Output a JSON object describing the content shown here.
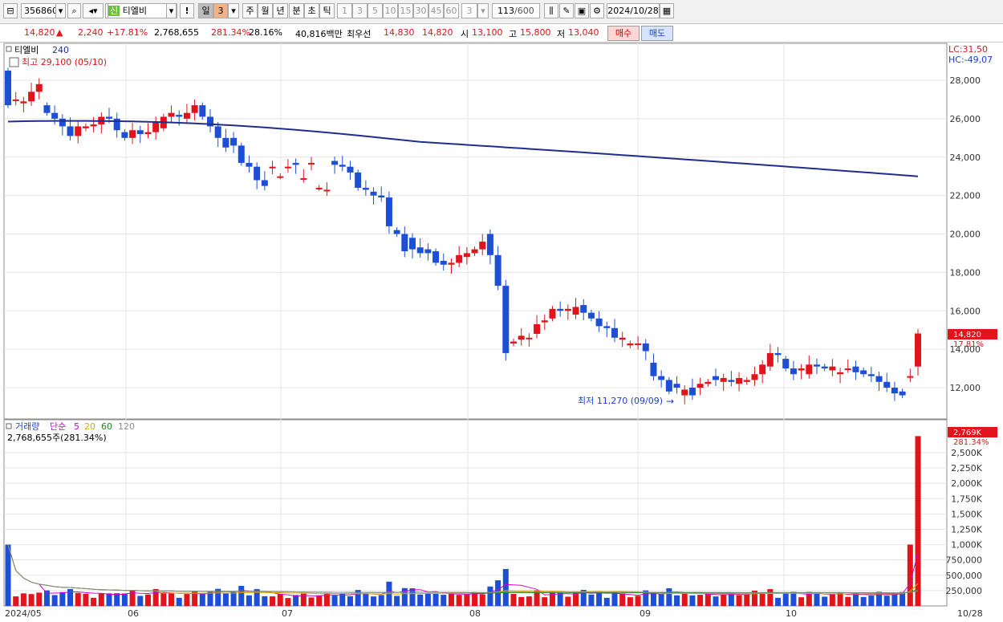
{
  "toolbar": {
    "code": "356860",
    "tag": "신",
    "name": "티엘비",
    "period_buttons": [
      "일",
      "주",
      "월",
      "년",
      "분",
      "초",
      "틱"
    ],
    "active_period": "일",
    "period_count": "3",
    "minute_values": [
      "1",
      "3",
      "5",
      "10",
      "15",
      "30",
      "45",
      "60"
    ],
    "minute_count": "3",
    "data_count": "113",
    "data_total": "/600",
    "date": "2024/10/28",
    "exclaim": "!"
  },
  "quote": {
    "price": "14,820",
    "change": "2,240",
    "change_pct": "+17.81%",
    "volume": "2,768,655",
    "vol_ratio": "281.34%",
    "turnover": "28.16%",
    "amount": "40,816백만",
    "best_label": "최우선",
    "best_ask": "14,830",
    "best_bid": "14,820",
    "open_label": "시",
    "open": "13,100",
    "high_label": "고",
    "high": "15,800",
    "low_label": "저",
    "low": "13,040",
    "buy_button": "매수",
    "sell_button": "매도"
  },
  "price_panel": {
    "name": "티엘비",
    "ma_period": "240",
    "high_note": "최고 29,100 (05/10)",
    "low_note": "최저 11,270 (09/09)",
    "lc": "LC:31,50",
    "hc": "HC:-49,07",
    "cur_price_tag": "14,820",
    "cur_pct_tag": "17.81%",
    "axis_labels": [
      "28,000",
      "26,000",
      "24,000",
      "22,000",
      "20,000",
      "18,000",
      "16,000",
      "14,000",
      "12,000"
    ]
  },
  "volume_panel": {
    "title": "거래량",
    "ma_label": "단순",
    "ma_periods": [
      "5",
      "20",
      "60",
      "120"
    ],
    "current": "2,768,655주(281.34%)",
    "cur_tag": "2,769K",
    "cur_pct_tag": "281.34%",
    "axis_labels": [
      "2,500K",
      "2,250K",
      "2,000K",
      "1,750K",
      "1,500K",
      "1,250K",
      "1,000K",
      "750,000",
      "500,000",
      "250,000"
    ]
  },
  "date_axis": {
    "labels": [
      "2024/05",
      "06",
      "07",
      "08",
      "09",
      "10",
      "10/28"
    ]
  },
  "colors": {
    "up": "#e0141a",
    "down": "#1d4fd6",
    "ma240": "#1f2d8f",
    "ma5": "#d400d4",
    "ma20": "#d9a800",
    "ma60": "#1a8a1a",
    "ma120": "#8c8c8c",
    "grid": "#e4e4e4"
  },
  "chart_data": {
    "type": "candlestick",
    "x": [
      "05/02",
      "05/03",
      "05/07",
      "05/08",
      "05/09",
      "05/10",
      "05/13",
      "05/14",
      "05/16",
      "05/17",
      "05/20",
      "05/21",
      "05/22",
      "05/23",
      "05/24",
      "05/27",
      "05/28",
      "05/29",
      "05/30",
      "05/31",
      "06/03",
      "06/04",
      "06/05",
      "06/07",
      "06/10",
      "06/11",
      "06/12",
      "06/13",
      "06/14",
      "06/17",
      "06/18",
      "06/19",
      "06/20",
      "06/21",
      "06/24",
      "06/25",
      "06/26",
      "06/27",
      "06/28",
      "07/01",
      "07/02",
      "07/03",
      "07/04",
      "07/05",
      "07/08",
      "07/09",
      "07/10",
      "07/11",
      "07/12",
      "07/15",
      "07/16",
      "07/17",
      "07/18",
      "07/19",
      "07/22",
      "07/23",
      "07/24",
      "07/25",
      "07/26",
      "07/29",
      "07/30",
      "07/31",
      "08/01",
      "08/02",
      "08/05",
      "08/06",
      "08/07",
      "08/08",
      "08/09",
      "08/12",
      "08/13",
      "08/14",
      "08/16",
      "08/19",
      "08/20",
      "08/21",
      "08/22",
      "08/23",
      "08/26",
      "08/27",
      "08/28",
      "08/29",
      "08/30",
      "09/02",
      "09/03",
      "09/04",
      "09/05",
      "09/06",
      "09/09",
      "09/10",
      "09/11",
      "09/12",
      "09/13",
      "09/19",
      "09/20",
      "09/23",
      "09/24",
      "09/25",
      "09/26",
      "09/27",
      "09/30",
      "10/02",
      "10/04",
      "10/07",
      "10/08",
      "10/10",
      "10/11",
      "10/14",
      "10/15",
      "10/16",
      "10/17",
      "10/18",
      "10/21",
      "10/22",
      "10/23",
      "10/24",
      "10/25",
      "10/28"
    ],
    "open": [
      28500,
      27000,
      26800,
      26900,
      27400,
      26700,
      26300,
      26000,
      25600,
      25100,
      25500,
      25600,
      25700,
      26100,
      26000,
      25300,
      25000,
      25400,
      25200,
      25300,
      25500,
      26100,
      26200,
      26000,
      26300,
      26700,
      26100,
      25600,
      25000,
      25000,
      24600,
      23700,
      23500,
      22800,
      23500,
      23000,
      23500,
      23700,
      22900,
      23700,
      22400,
      22300,
      23800,
      23600,
      23500,
      23200,
      22400,
      22200,
      22000,
      21900,
      20200,
      20000,
      19800,
      19300,
      19200,
      19100,
      18600,
      18400,
      18500,
      18800,
      19000,
      19200,
      20000,
      18900,
      17300,
      14300,
      14500,
      14600,
      14800,
      15400,
      15600,
      16100,
      16000,
      15800,
      16300,
      15900,
      15600,
      15200,
      15100,
      14500,
      14200,
      14300,
      14300,
      13300,
      12600,
      12400,
      12200,
      11600,
      12000,
      12000,
      12200,
      12600,
      12300,
      12400,
      12200,
      12300,
      12400,
      12700,
      13100,
      13800,
      13500,
      13000,
      12900,
      12700,
      13200,
      13100,
      12900,
      12700,
      13000,
      13100,
      12900,
      12700,
      12600,
      12300,
      12000,
      11800,
      12600,
      13100
    ],
    "close": [
      26700,
      27000,
      26900,
      27400,
      27800,
      26300,
      26000,
      25600,
      25100,
      25600,
      25600,
      25700,
      26100,
      26000,
      25400,
      25000,
      25400,
      25200,
      25300,
      25800,
      26100,
      26300,
      26100,
      26300,
      26700,
      26100,
      25600,
      25000,
      24500,
      24600,
      23700,
      23500,
      22800,
      22500,
      23500,
      23000,
      23500,
      23600,
      22900,
      23700,
      22400,
      22300,
      23600,
      23500,
      23200,
      22400,
      22300,
      22000,
      21900,
      20400,
      20000,
      19100,
      19200,
      19000,
      19000,
      18500,
      18400,
      18500,
      18900,
      19000,
      19200,
      19600,
      18900,
      17300,
      13800,
      14400,
      14700,
      14600,
      15300,
      15500,
      16100,
      16000,
      16100,
      16200,
      15900,
      15600,
      15200,
      15100,
      14600,
      14600,
      14300,
      14300,
      13900,
      12600,
      12400,
      11800,
      12000,
      11900,
      11600,
      12200,
      12300,
      12400,
      12500,
      12300,
      12500,
      12400,
      12700,
      13200,
      13800,
      13700,
      13000,
      12700,
      13000,
      13200,
      13100,
      13000,
      13100,
      12800,
      13000,
      12800,
      12700,
      12600,
      12300,
      12000,
      11700,
      11600,
      12600,
      14820
    ]
  }
}
